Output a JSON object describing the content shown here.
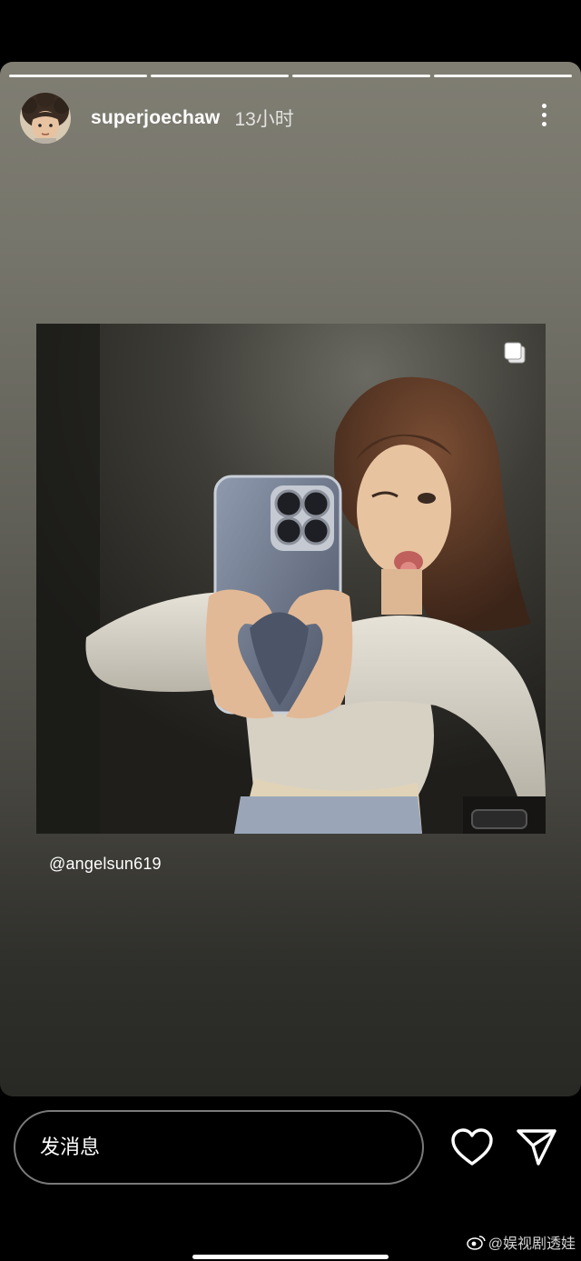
{
  "story": {
    "progress_segments": 4,
    "username": "superjoechaw",
    "time_ago": "13小时",
    "mention": "@angelsun619",
    "icons": {
      "avatar": "profile-avatar",
      "more": "more-vertical-icon",
      "multi_photo": "multiple-photos-icon"
    }
  },
  "reply_bar": {
    "placeholder": "发消息",
    "icons": {
      "like": "heart-icon",
      "send": "send-icon"
    }
  },
  "watermark": {
    "text": "@娱视剧透娃",
    "icon": "weibo-logo-icon"
  },
  "colors": {
    "story_top": "#807e73",
    "story_bottom": "#282825",
    "accent_text": "#ffffff",
    "input_border": "#7a7a7a"
  }
}
